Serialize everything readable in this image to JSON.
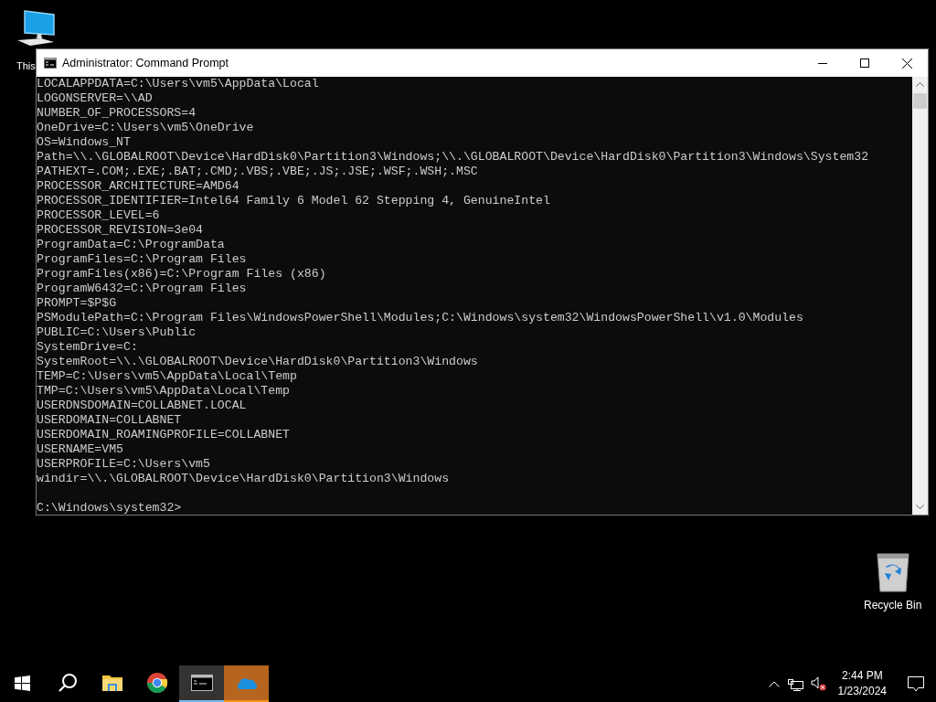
{
  "desktop_icons": [
    {
      "kind": "computer",
      "label": "This"
    },
    {
      "kind": "recycle-bin",
      "label": "Recycle Bin"
    }
  ],
  "window": {
    "title": "Administrator: Command Prompt",
    "lines": [
      "LOCALAPPDATA=C:\\Users\\vm5\\AppData\\Local",
      "LOGONSERVER=\\\\AD",
      "NUMBER_OF_PROCESSORS=4",
      "OneDrive=C:\\Users\\vm5\\OneDrive",
      "OS=Windows_NT",
      "Path=\\\\.\\GLOBALROOT\\Device\\HardDisk0\\Partition3\\Windows;\\\\.\\GLOBALROOT\\Device\\HardDisk0\\Partition3\\Windows\\System32",
      "PATHEXT=.COM;.EXE;.BAT;.CMD;.VBS;.VBE;.JS;.JSE;.WSF;.WSH;.MSC",
      "PROCESSOR_ARCHITECTURE=AMD64",
      "PROCESSOR_IDENTIFIER=Intel64 Family 6 Model 62 Stepping 4, GenuineIntel",
      "PROCESSOR_LEVEL=6",
      "PROCESSOR_REVISION=3e04",
      "ProgramData=C:\\ProgramData",
      "ProgramFiles=C:\\Program Files",
      "ProgramFiles(x86)=C:\\Program Files (x86)",
      "ProgramW6432=C:\\Program Files",
      "PROMPT=$P$G",
      "PSModulePath=C:\\Program Files\\WindowsPowerShell\\Modules;C:\\Windows\\system32\\WindowsPowerShell\\v1.0\\Modules",
      "PUBLIC=C:\\Users\\Public",
      "SystemDrive=C:",
      "SystemRoot=\\\\.\\GLOBALROOT\\Device\\HardDisk0\\Partition3\\Windows",
      "TEMP=C:\\Users\\vm5\\AppData\\Local\\Temp",
      "TMP=C:\\Users\\vm5\\AppData\\Local\\Temp",
      "USERDNSDOMAIN=COLLABNET.LOCAL",
      "USERDOMAIN=COLLABNET",
      "USERDOMAIN_ROAMINGPROFILE=COLLABNET",
      "USERNAME=VM5",
      "USERPROFILE=C:\\Users\\vm5",
      "windir=\\\\.\\GLOBALROOT\\Device\\HardDisk0\\Partition3\\Windows"
    ],
    "prompt": "C:\\Windows\\system32>"
  },
  "taskbar": {
    "buttons": [
      {
        "kind": "start",
        "selected": false,
        "attention": false
      },
      {
        "kind": "search",
        "selected": false,
        "attention": false
      },
      {
        "kind": "explorer",
        "selected": false,
        "attention": false
      },
      {
        "kind": "chrome",
        "selected": false,
        "attention": false
      },
      {
        "kind": "terminal",
        "selected": true,
        "attention": false
      },
      {
        "kind": "onedrive",
        "selected": false,
        "attention": true
      }
    ],
    "tray": {
      "volume_muted": true,
      "time": "2:44 PM",
      "date": "1/23/2024"
    }
  }
}
